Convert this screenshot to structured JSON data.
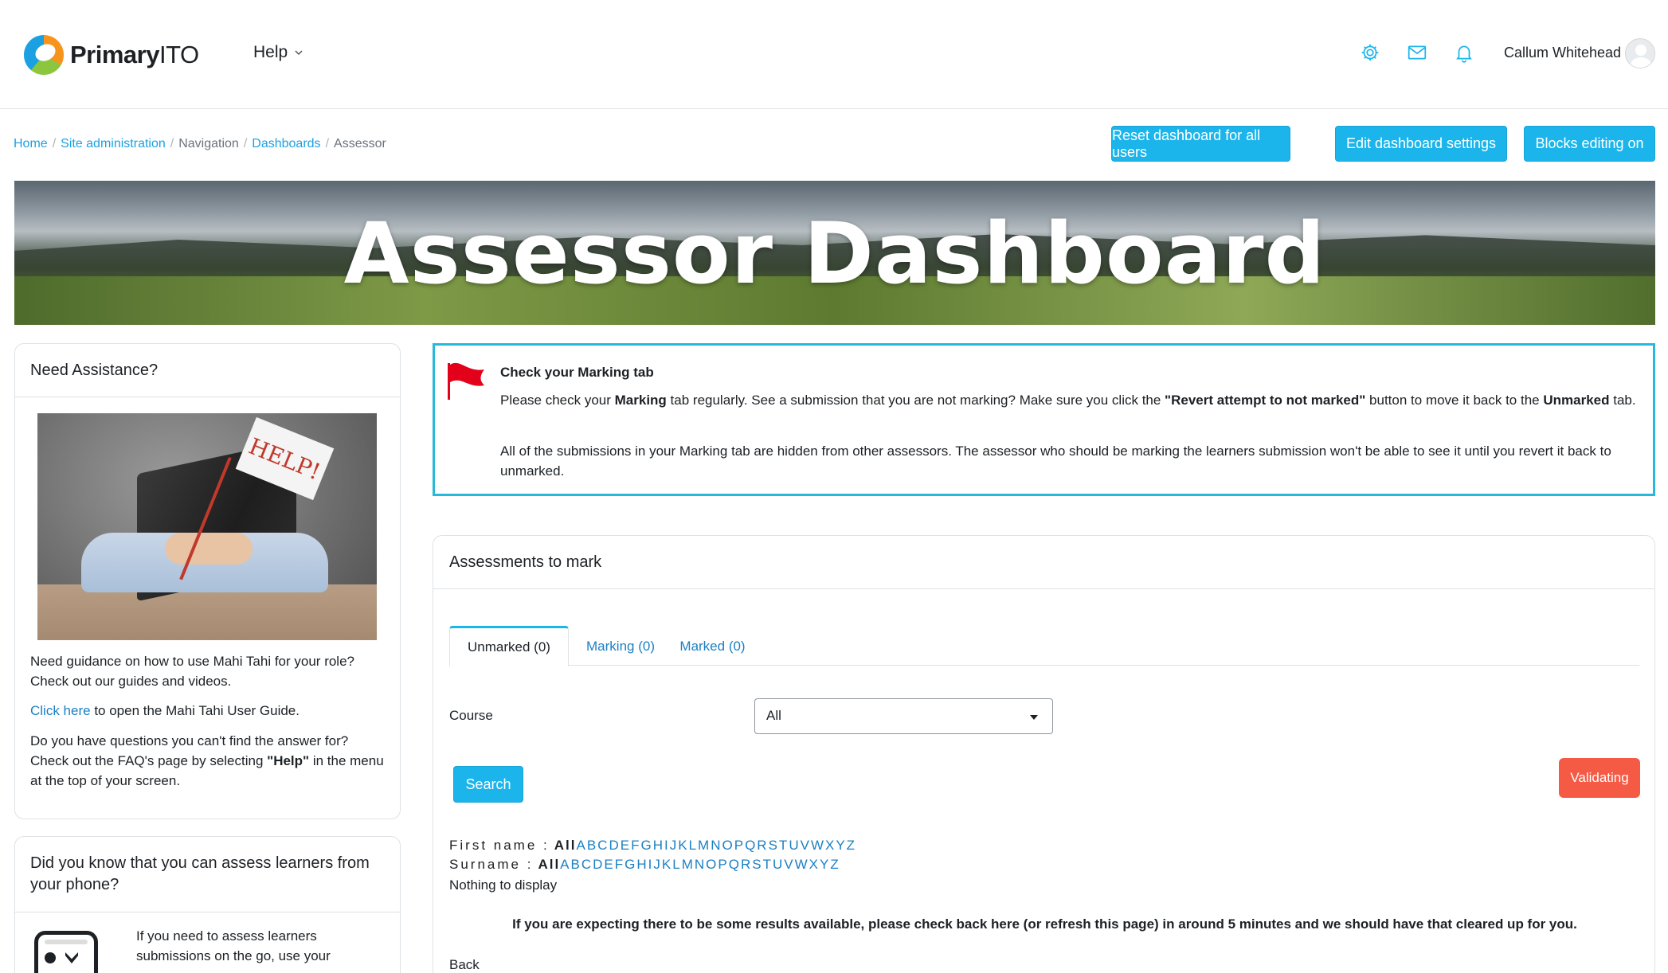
{
  "navbar": {
    "logo_bold": "Primary",
    "logo_light": "ITO",
    "help_label": "Help",
    "user_name": "Callum Whitehead"
  },
  "breadcrumb": [
    "Home",
    "Site administration",
    "Navigation",
    "Dashboards",
    "Assessor"
  ],
  "top_buttons": {
    "reset": "Reset dashboard for all users",
    "edit": "Edit dashboard settings",
    "blocks": "Blocks editing on"
  },
  "banner": {
    "title": "Assessor Dashboard"
  },
  "need_assistance": {
    "title": "Need Assistance?",
    "image_text": "HELP!",
    "p1": "Need guidance on how to use Mahi Tahi for your role? Check out our guides and videos.",
    "p2_link": "Click here",
    "p2_rest": " to open the Mahi Tahi User Guide.",
    "p3_a": "Do you have questions you can't find the answer for? Check out the FAQ's page by selecting ",
    "p3_bold": "\"Help\"",
    "p3_b": " in the menu at the top of your screen."
  },
  "phone_card": {
    "title": "Did you know that you can assess learners from your phone?",
    "text": "If you need to assess learners submissions on the go, use your"
  },
  "alert": {
    "title": "Check your Marking tab",
    "p1_a": "Please check your ",
    "p1_b": "Marking",
    "p1_c": " tab regularly. See a submission that you are not marking? Make sure you click the ",
    "p1_d": "\"Revert attempt to not marked\"",
    "p1_e": " button to move it back to the ",
    "p1_f": "Unmarked",
    "p1_g": " tab.",
    "p2": "All of the submissions in your Marking tab are hidden from other assessors. The assessor who should be marking the learners submission won't be able to see it until you revert it back to unmarked."
  },
  "assessments": {
    "title": "Assessments to mark",
    "tabs": [
      "Unmarked (0)",
      "Marking (0)",
      "Marked (0)"
    ],
    "course_label": "Course",
    "course_value": "All",
    "search_label": "Search",
    "validating_label": "Validating",
    "first_name_label": "First name :",
    "surname_label": "Surname :",
    "all_label": "All",
    "letters": [
      "A",
      "B",
      "C",
      "D",
      "E",
      "F",
      "G",
      "H",
      "I",
      "J",
      "K",
      "L",
      "M",
      "N",
      "O",
      "P",
      "Q",
      "R",
      "S",
      "T",
      "U",
      "V",
      "W",
      "X",
      "Y",
      "Z"
    ],
    "nothing": "Nothing to display",
    "notice": "If you are expecting there to be some results available, please check back here (or refresh this page) in around 5 minutes and we should have that cleared up for you.",
    "back": "Back"
  },
  "colors": {
    "accent": "#1cb5eb",
    "link": "#1c80c4",
    "validating": "#f55a45",
    "alert_border": "#27b9d9"
  },
  "icons": [
    "gear-icon",
    "mail-icon",
    "bell-icon",
    "avatar-icon",
    "flag-icon",
    "chevron-down-icon"
  ]
}
